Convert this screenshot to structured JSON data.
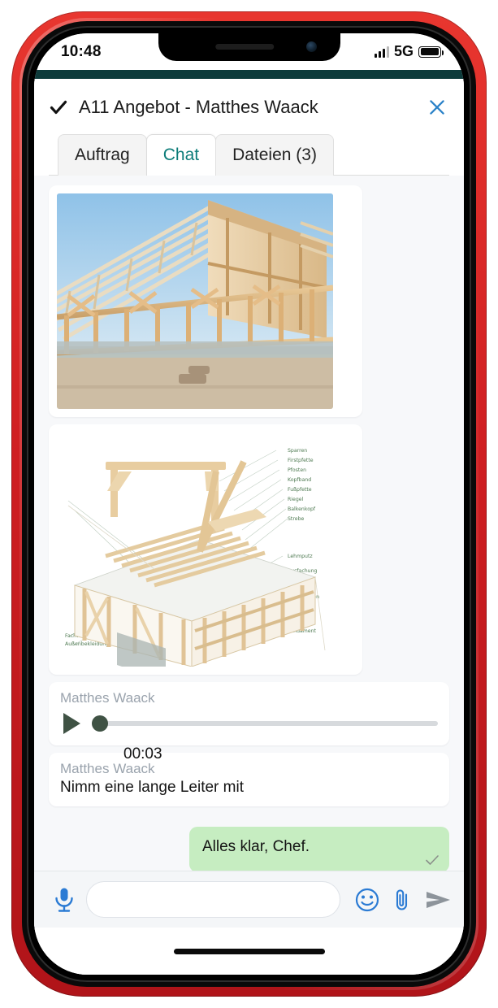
{
  "status_bar": {
    "time": "10:48",
    "network": "5G",
    "signal_icon": "signal-bars-icon",
    "battery_icon": "battery-full-icon"
  },
  "header": {
    "check_icon": "checkmark-icon",
    "title": "A11 Angebot - Matthes Waack",
    "close_icon": "close-icon",
    "tabs": [
      {
        "label": "Auftrag",
        "active": false
      },
      {
        "label": "Chat",
        "active": true
      },
      {
        "label": "Dateien (3)",
        "active": false
      }
    ]
  },
  "chat": {
    "messages": [
      {
        "type": "image",
        "name": "timber-frame-photo",
        "alt": "Foto eines Holzfachwerk-Rohbaus mit Dachstuhl"
      },
      {
        "type": "image",
        "name": "timber-frame-diagram",
        "alt": "Beschriftete 3D-Zeichnung einer Fachwerk-Konstruktion"
      },
      {
        "type": "voice",
        "sender": "Matthes Waack",
        "duration": "00:03",
        "play_icon": "play-icon",
        "progress": 0
      },
      {
        "type": "text-in",
        "sender": "Matthes Waack",
        "text": "Nimm eine lange Leiter mit"
      },
      {
        "type": "text-out",
        "text": "Alles klar, Chef.",
        "status_icon": "single-check-icon"
      }
    ]
  },
  "composer": {
    "mic_icon": "microphone-icon",
    "input_value": "",
    "input_placeholder": "",
    "emoji_icon": "emoji-icon",
    "attach_icon": "paperclip-icon",
    "send_icon": "send-icon"
  },
  "colors": {
    "accent_teal": "#0c7c79",
    "header_strip": "#0d3b3b",
    "outgoing_bubble": "#c6edc1",
    "icon_blue": "#2b82c8",
    "case_red": "#cf1f22",
    "chat_background": "#f7f8fa"
  }
}
